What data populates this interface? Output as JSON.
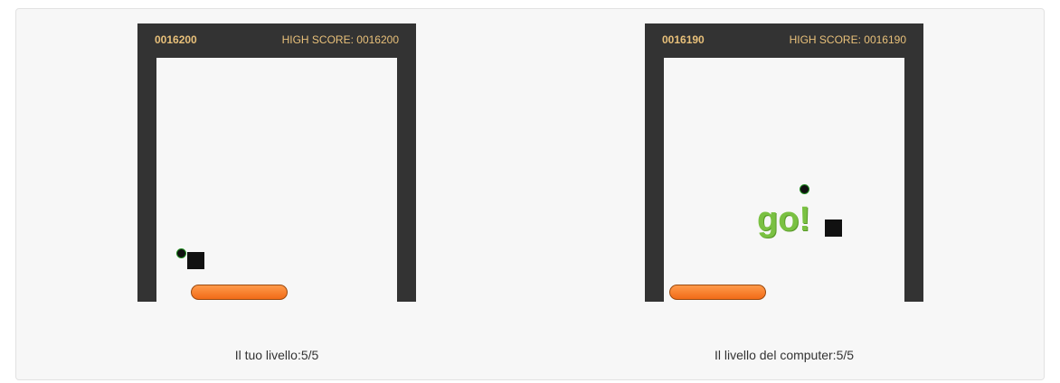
{
  "player": {
    "score": "0016200",
    "high_score": "HIGH SCORE: 0016200",
    "level_label": "Il tuo livello:5/5"
  },
  "computer": {
    "score": "0016190",
    "high_score": "HIGH SCORE: 0016190",
    "level_label": "Il livello del computer:5/5",
    "go_text": "go!"
  }
}
